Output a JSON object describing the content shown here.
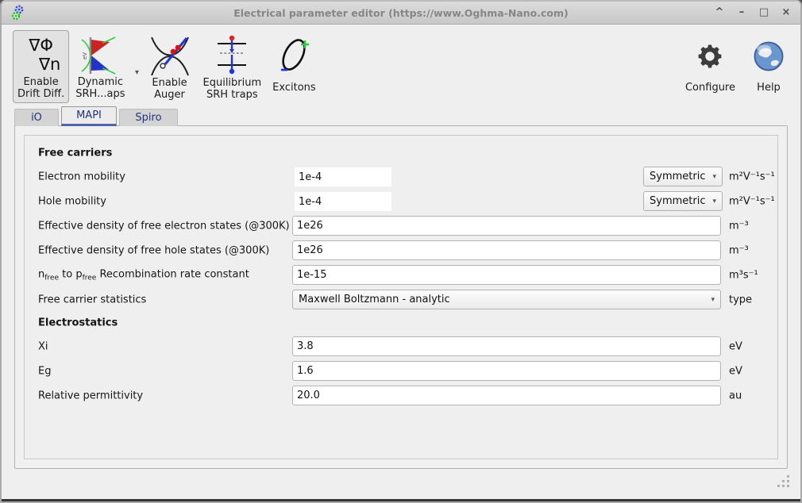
{
  "window": {
    "title": "Electrical parameter editor (https://www.Oghma-Nano.com)",
    "controls": {
      "rollup": "^",
      "minimize": "–",
      "maximize": "□",
      "close": "×"
    }
  },
  "toolbar": {
    "buttons": [
      {
        "glyph_line1": "∇Φ",
        "glyph_line2": "∇n",
        "line1": "Enable",
        "line2": "Drift Diff.",
        "active": true
      },
      {
        "line1": "Dynamic",
        "line2": "SRH...aps",
        "has_dropdown": true
      },
      {
        "line1": "Enable",
        "line2": "Auger"
      },
      {
        "line1": "Equilibrium",
        "line2": "SRH traps"
      },
      {
        "line1": "Excitons",
        "line2": ""
      }
    ],
    "configure_label": "Configure",
    "help_label": "Help"
  },
  "tabs": [
    {
      "label": "iO",
      "active": false
    },
    {
      "label": "MAPI",
      "active": true
    },
    {
      "label": "Spiro",
      "active": false
    }
  ],
  "form": {
    "rows": [
      {
        "type": "header",
        "label": "Free carriers"
      },
      {
        "label": "Electron mobility",
        "value": "1e-4",
        "select": "Symmetric",
        "unit": "m²V⁻¹s⁻¹"
      },
      {
        "label": "Hole mobility",
        "value": "1e-4",
        "select": "Symmetric",
        "unit": "m²V⁻¹s⁻¹"
      },
      {
        "label": "Effective density of free electron states (@300K)",
        "value": "1e26",
        "unit": "m⁻³"
      },
      {
        "label": "Effective density of free hole states (@300K)",
        "value": "1e26",
        "unit": "m⁻³"
      },
      {
        "label_pre": "n",
        "label_sub1": "free",
        "label_mid": " to p",
        "label_sub2": "free",
        "label_post": " Recombination rate constant",
        "value": "1e-15",
        "unit": "m³s⁻¹"
      },
      {
        "label": "Free carrier statistics",
        "select": "Maxwell Boltzmann - analytic",
        "unit": "type"
      },
      {
        "type": "header",
        "label": "Electrostatics"
      },
      {
        "label": "Xi",
        "value": "3.8",
        "unit": "eV"
      },
      {
        "label": "Eg",
        "value": "1.6",
        "unit": "eV"
      },
      {
        "label": "Relative permittivity",
        "value": "20.0",
        "unit": "au"
      }
    ]
  },
  "icons": {
    "dropdown_arrow": "▾"
  },
  "colors": {
    "tab_accent": "#5263ae",
    "tab_text": "#26327a",
    "srh_red": "#cc2222",
    "srh_blue": "#2233cc",
    "exciton_green": "#2ecc40"
  }
}
